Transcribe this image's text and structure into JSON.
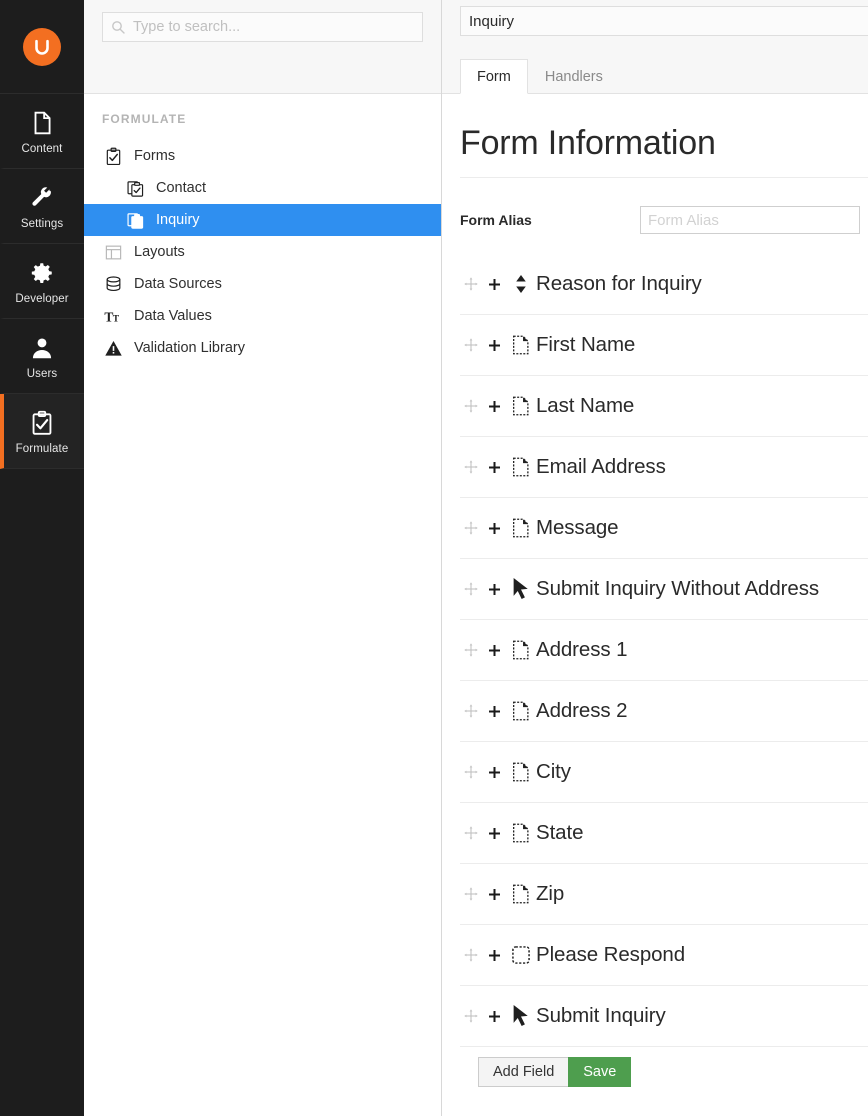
{
  "app": {
    "logo_icon": "umbraco-logo-icon",
    "accent_orange": "#f36f21",
    "selection_blue": "#2f8ff0",
    "save_green": "#4e9e4e"
  },
  "rail": {
    "items": [
      {
        "label": "Content",
        "icon": "document-icon",
        "active": false
      },
      {
        "label": "Settings",
        "icon": "wrench-icon",
        "active": false
      },
      {
        "label": "Developer",
        "icon": "gear-icon",
        "active": false
      },
      {
        "label": "Users",
        "icon": "user-icon",
        "active": false
      },
      {
        "label": "Formulate",
        "icon": "clipboard-check-icon",
        "active": true
      }
    ]
  },
  "search": {
    "placeholder": "Type to search...",
    "value": "",
    "icon": "search-icon"
  },
  "tree": {
    "section_title": "FORMULATE",
    "nodes": [
      {
        "label": "Forms",
        "icon": "clipboard-check-icon",
        "level": 1,
        "selected": false
      },
      {
        "label": "Contact",
        "icon": "form-icon",
        "level": 2,
        "selected": false
      },
      {
        "label": "Inquiry",
        "icon": "form-icon",
        "level": 2,
        "selected": true
      },
      {
        "label": "Layouts",
        "icon": "layout-icon",
        "level": 1,
        "selected": false
      },
      {
        "label": "Data Sources",
        "icon": "database-icon",
        "level": 1,
        "selected": false
      },
      {
        "label": "Data Values",
        "icon": "text-size-icon",
        "level": 1,
        "selected": false
      },
      {
        "label": "Validation Library",
        "icon": "warning-icon",
        "level": 1,
        "selected": false
      }
    ]
  },
  "header": {
    "name_value": "Inquiry",
    "tabs": [
      {
        "label": "Form",
        "active": true
      },
      {
        "label": "Handlers",
        "active": false
      }
    ]
  },
  "form": {
    "page_title": "Form Information",
    "alias_label": "Form Alias",
    "alias_value": "",
    "alias_placeholder": "Form Alias",
    "fields": [
      {
        "label": "Reason for Inquiry",
        "icon": "dropdown-icon"
      },
      {
        "label": "First Name",
        "icon": "text-field-icon"
      },
      {
        "label": "Last Name",
        "icon": "text-field-icon"
      },
      {
        "label": "Email Address",
        "icon": "text-field-icon"
      },
      {
        "label": "Message",
        "icon": "text-field-icon"
      },
      {
        "label": "Submit Inquiry Without Address",
        "icon": "button-cursor-icon"
      },
      {
        "label": "Address 1",
        "icon": "text-field-icon"
      },
      {
        "label": "Address 2",
        "icon": "text-field-icon"
      },
      {
        "label": "City",
        "icon": "text-field-icon"
      },
      {
        "label": "State",
        "icon": "text-field-icon"
      },
      {
        "label": "Zip",
        "icon": "text-field-icon"
      },
      {
        "label": "Please Respond",
        "icon": "checkbox-icon"
      },
      {
        "label": "Submit Inquiry",
        "icon": "button-cursor-icon"
      }
    ],
    "row_handle_icon": "move-cross-icon",
    "row_add_icon": "plus-icon",
    "add_field_label": "Add Field",
    "save_label": "Save"
  }
}
